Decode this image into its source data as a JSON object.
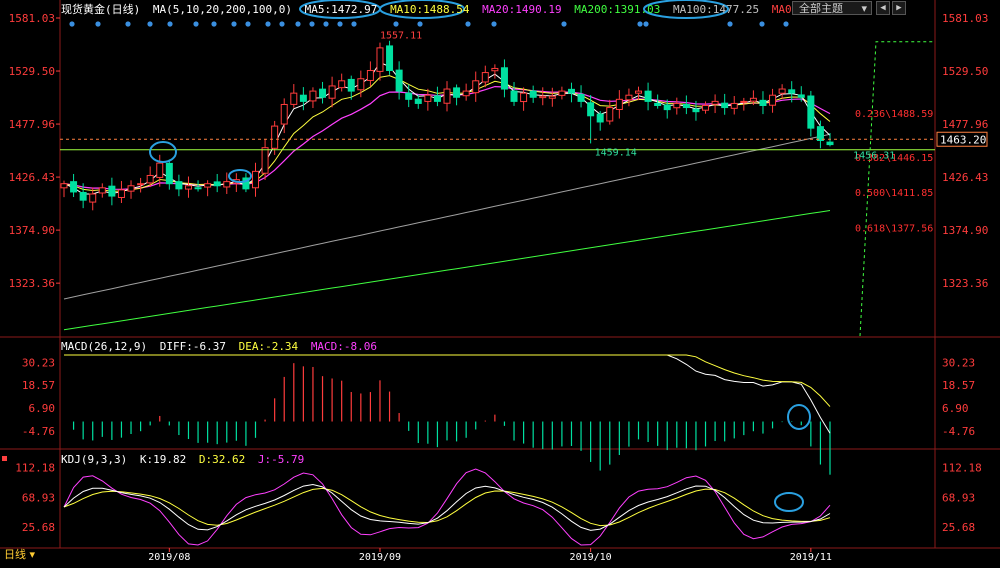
{
  "header": {
    "symbol": "现货黄金(日线)",
    "ma_params": "MA(5,10,20,200,100,0)",
    "ma5": "MA5:1472.97",
    "ma10": "MA10:1488.54",
    "ma20": "MA20:1490.19",
    "ma200": "MA200:1391.03",
    "ma100": "MA100:1477.25",
    "ma0": "MA0",
    "main_indicator_btn": "全部主题",
    "nav_left": "◀",
    "nav_right": "▶"
  },
  "colors": {
    "up": "#ff3c3c",
    "down": "#00e0a0",
    "ma5": "#ffffff",
    "ma10": "#ffff40",
    "ma20": "#ff40ff",
    "ma100": "#a0a0a0",
    "ma200": "#40ff40",
    "axis_text": "#ff3c3c",
    "circle": "#2aa0e0",
    "fib": "#ff3030"
  },
  "timeframe_label": "日线",
  "macd_header": {
    "params": "MACD(26,12,9)",
    "diff": "DIFF:-6.37",
    "dea": "DEA:-2.34",
    "macd": "MACD:-8.06"
  },
  "kdj_header": {
    "params": "KDJ(9,3,3)",
    "k": "K:19.82",
    "d": "D:32.62",
    "j": "J:-5.79"
  },
  "chart_data": {
    "type": "candlestick",
    "price_ticks": [
      1581.03,
      1529.5,
      1477.96,
      1426.43,
      1374.9,
      1323.36
    ],
    "price_tick_labels": [
      "1581.03",
      "1529.50",
      "1477.96",
      "1426.43",
      "1374.90",
      "1323.36"
    ],
    "ylim": [
      1272,
      1581.03
    ],
    "x_ticks": [
      "2019/08",
      "2019/09",
      "2019/10",
      "2019/11"
    ],
    "x_tick_index": [
      11,
      33,
      55,
      78
    ],
    "current_price": "1463.20",
    "current_price_value": 1463.2,
    "annotations": [
      {
        "label": "1557.11",
        "index": 33,
        "value": 1557.11
      },
      {
        "label": "1459.14",
        "index": 55,
        "value": 1459.14
      },
      {
        "label": "1456.31",
        "index": 82,
        "value": 1456.31
      }
    ],
    "fib_levels": [
      {
        "label": "0.236\\1488.59",
        "value": 1488.59
      },
      {
        "label": "0.382\\1446.15",
        "value": 1446.15
      },
      {
        "label": "0.500\\1411.85",
        "value": 1411.85
      },
      {
        "label": "0.618\\1377.56",
        "value": 1377.56
      }
    ],
    "hline_values": [
      1463.2,
      1453.0
    ],
    "closes": [
      1420,
      1412,
      1404,
      1410,
      1416,
      1408,
      1414,
      1418,
      1420,
      1428,
      1440,
      1420,
      1415,
      1418,
      1416,
      1420,
      1418,
      1422,
      1424,
      1415,
      1432,
      1455,
      1476,
      1497,
      1508,
      1500,
      1510,
      1504,
      1515,
      1520,
      1510,
      1522,
      1530,
      1552,
      1530,
      1510,
      1502,
      1498,
      1506,
      1500,
      1512,
      1504,
      1510,
      1520,
      1528,
      1532,
      1512,
      1500,
      1508,
      1504,
      1505,
      1505,
      1510,
      1508,
      1500,
      1486,
      1480,
      1494,
      1502,
      1506,
      1510,
      1500,
      1496,
      1492,
      1498,
      1494,
      1490,
      1496,
      1500,
      1494,
      1498,
      1500,
      1503,
      1496,
      1506,
      1512,
      1508,
      1504,
      1474,
      1462,
      1458
    ],
    "macd_ticks": [
      30.23,
      18.57,
      6.9,
      -4.76
    ],
    "macd_tick_labels": [
      "30.23",
      "18.57",
      "6.90",
      "-4.76"
    ],
    "kdj_ticks": [
      112.18,
      68.93,
      25.68
    ],
    "kdj_tick_labels": [
      "112.18",
      "68.93",
      "25.68"
    ]
  }
}
